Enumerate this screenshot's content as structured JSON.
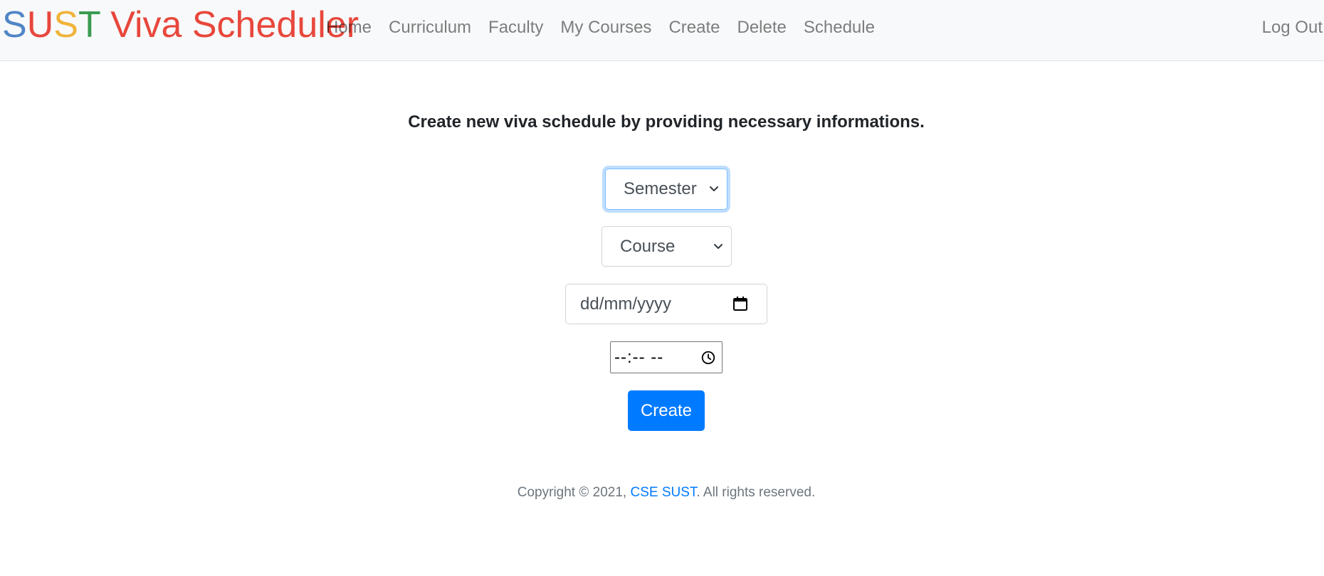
{
  "navbar": {
    "brand": {
      "letter_s1": "S",
      "letter_u": "U",
      "letter_s2": "S",
      "letter_t": "T",
      "rest": " Viva Scheduler"
    },
    "links": [
      {
        "label": "Home"
      },
      {
        "label": "Curriculum"
      },
      {
        "label": "Faculty"
      },
      {
        "label": "My Courses"
      },
      {
        "label": "Create"
      },
      {
        "label": "Delete"
      },
      {
        "label": "Schedule"
      }
    ],
    "logout_label": "Log Out"
  },
  "form": {
    "heading": "Create new viva schedule by providing necessary informations.",
    "semester_select": "Semester",
    "course_select": "Course",
    "date_placeholder": "dd/mm/yyyy",
    "time_placeholder": "--:-- --",
    "submit_label": "Create"
  },
  "footer": {
    "prefix": "Copyright © 2021, ",
    "link": "CSE SUST",
    "suffix": ". All rights reserved."
  },
  "icons": {
    "chevron": "chevron-down-icon",
    "calendar": "calendar-icon",
    "clock": "clock-icon"
  },
  "colors": {
    "brand_blue": "#4f86c6",
    "brand_red": "#e8473c",
    "brand_yellow": "#f0b43a",
    "brand_green": "#3a9b52",
    "primary": "#007bff"
  }
}
